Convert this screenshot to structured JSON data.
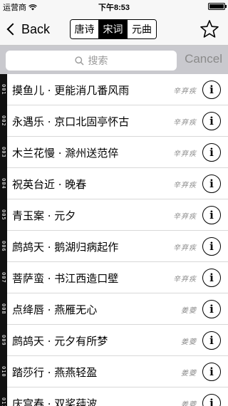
{
  "status_bar": {
    "carrier": "运营商",
    "time": "下午8:53",
    "battery_level": 1.0
  },
  "nav": {
    "back_label": "Back",
    "segments": [
      {
        "label": "唐诗",
        "selected": false
      },
      {
        "label": "宋词",
        "selected": true
      },
      {
        "label": "元曲",
        "selected": false
      }
    ],
    "star_icon": "star-outline-icon"
  },
  "search": {
    "placeholder": "搜索",
    "cancel_label": "Cancel"
  },
  "rows": [
    {
      "index": "001",
      "title": "摸鱼儿 · 更能消几番风雨",
      "author": "辛弃疾"
    },
    {
      "index": "002",
      "title": "永遇乐 · 京口北固亭怀古",
      "author": "辛弃疾"
    },
    {
      "index": "003",
      "title": "木兰花慢 · 滁州送范倅",
      "author": "辛弃疾"
    },
    {
      "index": "004",
      "title": "祝英台近 · 晚春",
      "author": "辛弃疾"
    },
    {
      "index": "005",
      "title": "青玉案 · 元夕",
      "author": "辛弃疾"
    },
    {
      "index": "006",
      "title": "鹧鸪天 · 鹅湖归病起作",
      "author": "辛弃疾"
    },
    {
      "index": "007",
      "title": "菩萨蛮 · 书江西造口壁",
      "author": "辛弃疾"
    },
    {
      "index": "008",
      "title": "点绛唇 · 燕雁无心",
      "author": "姜夔"
    },
    {
      "index": "009",
      "title": "鹧鸪天 · 元夕有所梦",
      "author": "姜夔"
    },
    {
      "index": "010",
      "title": "踏莎行 · 燕燕轻盈",
      "author": "姜夔"
    },
    {
      "index": "011",
      "title": "庆宫春 · 双桨莼波",
      "author": "姜夔"
    }
  ]
}
